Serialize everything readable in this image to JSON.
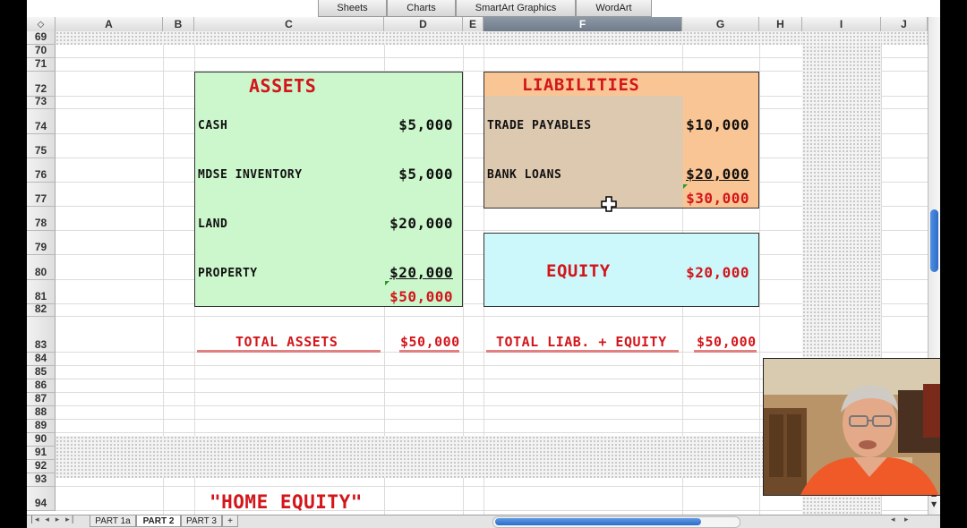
{
  "ribbon": {
    "tabs": [
      "Sheets",
      "Charts",
      "SmartArt Graphics",
      "WordArt"
    ]
  },
  "columns": [
    "A",
    "B",
    "C",
    "D",
    "E",
    "F",
    "G",
    "H",
    "I",
    "J"
  ],
  "selected_column": "F",
  "rows": [
    "69",
    "70",
    "71",
    "72",
    "73",
    "74",
    "75",
    "76",
    "77",
    "78",
    "79",
    "80",
    "81",
    "82",
    "83",
    "84",
    "85",
    "86",
    "87",
    "88",
    "89",
    "90",
    "91",
    "92",
    "93",
    "94"
  ],
  "assets": {
    "title": "ASSETS",
    "items": [
      {
        "label": "CASH",
        "value": "$5,000"
      },
      {
        "label": "MDSE INVENTORY",
        "value": "$5,000"
      },
      {
        "label": "LAND",
        "value": "$20,000"
      },
      {
        "label": "PROPERTY",
        "value": "$20,000"
      }
    ],
    "subtotal": "$50,000"
  },
  "liabilities": {
    "title": "LIABILITIES",
    "items": [
      {
        "label": "TRADE PAYABLES",
        "value": "$10,000"
      },
      {
        "label": "BANK LOANS",
        "value": "$20,000"
      }
    ],
    "subtotal": "$30,000"
  },
  "equity": {
    "title": "EQUITY",
    "value": "$20,000"
  },
  "totals": {
    "assets_label": "TOTAL ASSETS",
    "assets_value": "$50,000",
    "liab_equity_label": "TOTAL LIAB. + EQUITY",
    "liab_equity_value": "$50,000"
  },
  "home_equity_text": "\"HOME EQUITY\"",
  "sheet_tabs": [
    "PART 1a",
    "PART 2",
    "PART 3",
    "+"
  ],
  "active_sheet": "PART 2",
  "colors": {
    "assets_bg": "#ccf7cc",
    "liabilities_bg": "#ddc8b0",
    "liabilities_value_bg": "#fac595",
    "equity_bg": "#cdf8fb",
    "red_text": "#d2161b",
    "selected_header": "#7b8794"
  }
}
